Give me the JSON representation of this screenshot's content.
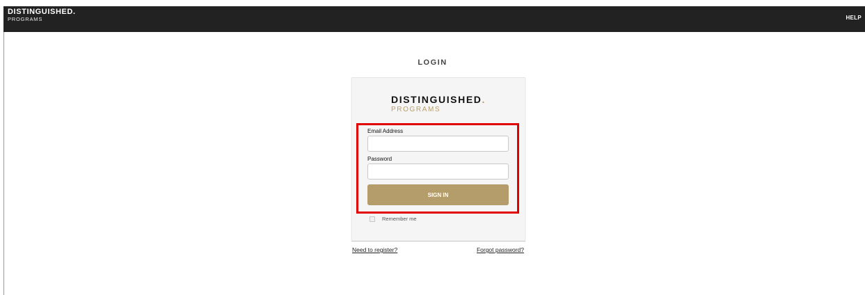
{
  "header": {
    "brand_main": "DISTINGUISHED",
    "brand_dot": ".",
    "brand_sub": "PROGRAMS",
    "help_label": "HELP"
  },
  "page": {
    "title": "LOGIN"
  },
  "card": {
    "logo_main": "DISTINGUISHED",
    "logo_dot": ".",
    "logo_sub": "PROGRAMS",
    "email_label": "Email Address",
    "email_value": "",
    "password_label": "Password",
    "password_value": "",
    "signin_label": "SIGN IN",
    "remember_label": "Remember me",
    "remember_checked": false
  },
  "links": {
    "register": "Need to register?",
    "forgot": "Forgot password?"
  },
  "colors": {
    "header_bg": "#222222",
    "accent_gold": "#b49d6b",
    "highlight_red": "#e00000",
    "card_bg": "#f5f5f5"
  },
  "icons": {
    "remember_checkbox": "checkbox-unchecked-icon"
  }
}
